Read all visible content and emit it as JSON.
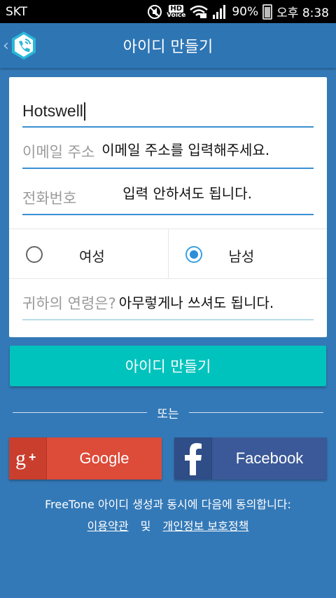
{
  "status_bar": {
    "carrier": "SKT",
    "hd_label": "HD",
    "voice_label": "Voice",
    "battery": "90%",
    "time": "오후 8:38"
  },
  "header": {
    "title": "아이디 만들기",
    "back_icon": "chevron-left-icon",
    "logo_icon": "phone-wifi-icon"
  },
  "form": {
    "name_value": "Hotswell",
    "email_placeholder": "이메일 주소",
    "email_hint": "이메일 주소를 입력해주세요.",
    "phone_placeholder": "전화번호",
    "phone_hint": "입력 안하셔도 됩니다.",
    "gender": {
      "female_label": "여성",
      "male_label": "남성",
      "selected": "남성"
    },
    "age_placeholder": "귀하의 연령은?",
    "age_hint": "아무렇게나 쓰셔도 됩니다."
  },
  "actions": {
    "create_label": "아이디 만들기",
    "divider_text": "또는",
    "google_label": "Google",
    "facebook_label": "Facebook"
  },
  "footer": {
    "agreement_text": "FreeTone 아이디 생성과 동시에 다음에 동의합니다:",
    "terms_link": "이용약관",
    "and_text": "및",
    "privacy_link": "개인정보 보호정책"
  },
  "colors": {
    "background": "#3479b7",
    "title_bar": "#2e75b4",
    "primary_button": "#00c3bd",
    "google": "#dd4b39",
    "facebook": "#3b5998",
    "field_underline": "#3a8fd1"
  }
}
